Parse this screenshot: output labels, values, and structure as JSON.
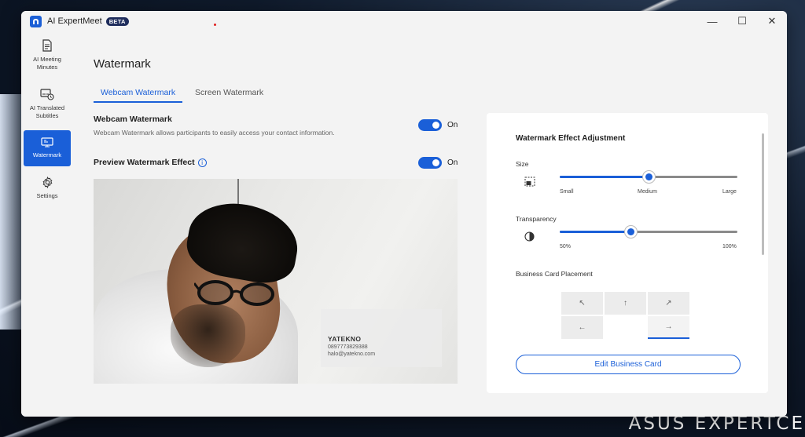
{
  "window": {
    "app_title": "AI ExpertMeet",
    "badge": "BETA",
    "controls": {
      "minimize": "—",
      "maximize": "☐",
      "close": "✕"
    }
  },
  "sidebar": {
    "items": [
      {
        "label": "AI Meeting Minutes",
        "icon": "document-icon",
        "active": false
      },
      {
        "label": "AI Translated Subtitles",
        "icon": "subtitles-icon",
        "active": false
      },
      {
        "label": "Watermark",
        "icon": "monitor-watermark-icon",
        "active": true
      },
      {
        "label": "Settings",
        "icon": "gear-icon",
        "active": false
      }
    ]
  },
  "main": {
    "title": "Watermark",
    "tabs": [
      {
        "label": "Webcam Watermark",
        "active": true
      },
      {
        "label": "Screen Watermark",
        "active": false
      }
    ],
    "webcam_watermark": {
      "label": "Webcam Watermark",
      "description": "Webcam Watermark allows participants to easily access your contact information.",
      "toggle_label": "On",
      "enabled": true
    },
    "preview": {
      "label": "Preview Watermark Effect",
      "info_icon": "info-icon",
      "toggle_label": "On",
      "enabled": true,
      "card": {
        "name": "YATEKNO",
        "phone": "0897773829388",
        "email": "halo@yatekno.com"
      }
    }
  },
  "panel": {
    "title": "Watermark Effect Adjustment",
    "size": {
      "label": "Size",
      "icon": "resize-icon",
      "value": 0.5,
      "ticks": [
        "Small",
        "Medium",
        "Large"
      ]
    },
    "transparency": {
      "label": "Transparency",
      "icon": "contrast-icon",
      "value": 0.4,
      "min_label": "50%",
      "max_label": "100%"
    },
    "placement": {
      "label": "Business Card Placement",
      "cells": {
        "top_left": "↖",
        "top_center": "↑",
        "top_right": "↗",
        "middle_left": "←",
        "middle_right": "→"
      },
      "selected": "middle_right"
    },
    "edit_button": "Edit Business Card"
  },
  "desktop": {
    "brand_text": "ASUS EXPERTCE"
  },
  "colors": {
    "accent": "#1a5fd8",
    "sidebar_active": "#1a5fd8"
  }
}
